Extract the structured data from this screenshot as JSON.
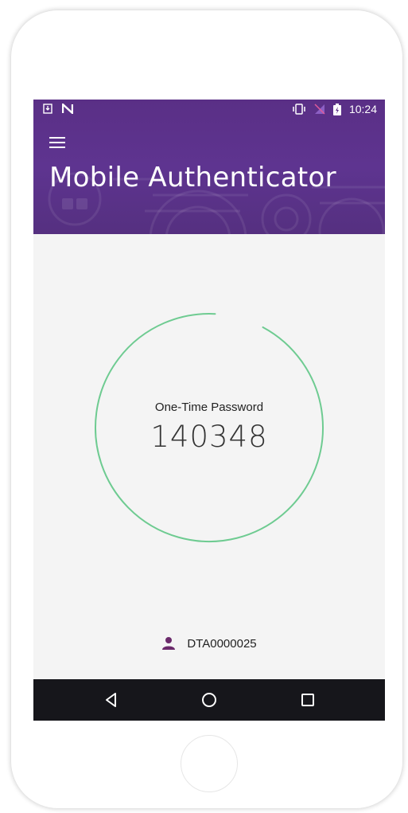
{
  "status_bar": {
    "time": "10:24"
  },
  "header": {
    "title": "Mobile Authenticator"
  },
  "otp": {
    "label": "One-Time Password",
    "code": "140348",
    "remaining_fraction": 0.93,
    "ring_color": "#6ecb91"
  },
  "user": {
    "id": "DTA0000025",
    "icon_color": "#6b2a6b"
  },
  "colors": {
    "header": "#5a2f86",
    "background": "#f4f4f4",
    "navbar": "#16161b"
  },
  "icons": {
    "menu": "menu-icon",
    "user": "person-icon",
    "back": "back-triangle-icon",
    "home": "home-circle-icon",
    "recents": "recents-square-icon"
  }
}
